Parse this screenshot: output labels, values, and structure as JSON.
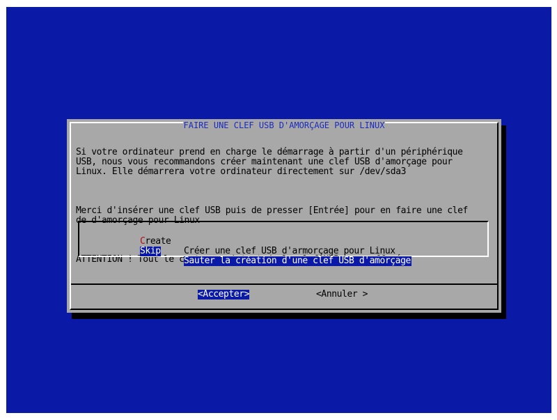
{
  "dialog": {
    "title": "FAIRE UNE CLEF USB D'AMORÇAGE POUR LINUX",
    "paragraphs": [
      "Si votre ordinateur prend en charge le démarrage à partir d'un périphérique\nUSB, nous vous recommandons créer maintenant une clef USB d'amorçage pour\nLinux. Elle démarrera votre ordinateur directement sur /dev/sda3",
      "Merci d'insérer une clef USB puis de presser [Entrée] pour en faire une clef\nde d'amorçage pour Linux",
      "ATTENTION ! Tout le contenu existant de la clef USB sera effacé."
    ],
    "menu": [
      {
        "hotkey": "C",
        "rest": "reate",
        "description": "Créer une clef USB d'armorçage pour Linux",
        "selected": false
      },
      {
        "hotkey": "S",
        "rest": "kip",
        "description": "Sauter la création d'une clef USB d'amorçage",
        "selected": true
      }
    ],
    "buttons": {
      "accept": "<Accepter>",
      "cancel": "<Annuler >"
    }
  },
  "colors": {
    "background": "#0a1aa6",
    "dialog": "#a8a8a8",
    "hotkey": "#b0101a",
    "selection": "#0a1aa6"
  }
}
